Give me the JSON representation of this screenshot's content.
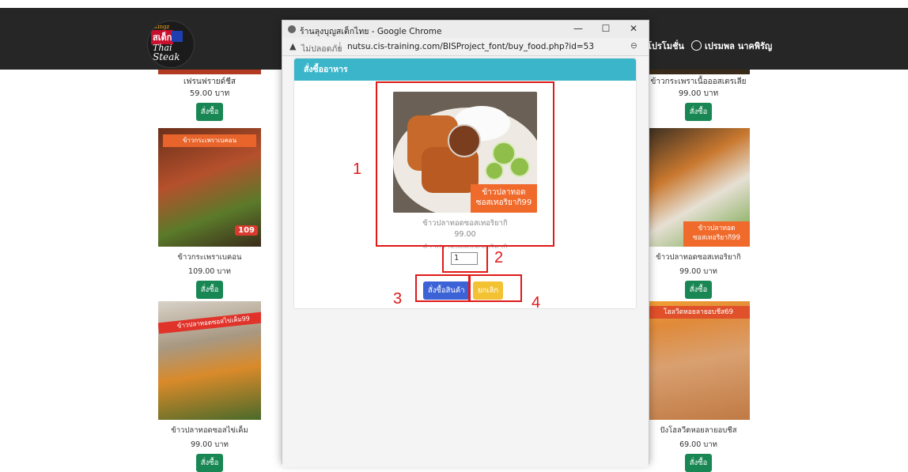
{
  "header": {
    "logo": {
      "line1": "kingz",
      "line2": "สเต็ก",
      "line3": "Thai",
      "line4": "Steak"
    },
    "nav_promo": "โปรโมชั่น",
    "nav_user": "เปรมพล นาคพิรัญ",
    "user_icon": "user-circle-icon"
  },
  "left_cards": [
    {
      "name": "เฟรนฟรายด์ชีส",
      "price": "59.00 บาท",
      "button": "สั่งซื้อ"
    },
    {
      "name": "ข้าวกระเพราเบคอน",
      "price": "109.00 บาท",
      "button": "สั่งซื้อ",
      "banner": "ข้าวกระเพราเบคอน",
      "badge": "109"
    },
    {
      "name": "ข้าวปลาทอดซอสไข่เค็ม",
      "price": "99.00 บาท",
      "button": "สั่งซื้อ",
      "banner": "ข้าวปลาทอดซอสไข่เค็ม99"
    }
  ],
  "right_cards": [
    {
      "name": "ข้าวกระเพราเนื้อออสเตรเลีย",
      "price": "99.00 บาท",
      "button": "สั่งซื้อ"
    },
    {
      "name": "ข้าวปลาทอดซอสเทอริยากิ",
      "price": "99.00 บาท",
      "button": "สั่งซื้อ",
      "tag_line1": "ข้าวปลาทอด",
      "tag_line2": "ซอสเทอริยากิ99"
    },
    {
      "name": "ปังโฮลวีตหอยลายอบชีส",
      "price": "69.00 บาท",
      "button": "สั่งซื้อ",
      "banner": "โฮลวีตหอยลายอบชีส69"
    }
  ],
  "popup": {
    "window_title": "ร้านลุงบุญสเต็กไทย - Google Chrome",
    "not_secure": "ไม่ปลอดภัย",
    "url": "nutsu.cis-training.com/BISProject_font/buy_food.php?id=53",
    "controls": {
      "minimize": "—",
      "maximize": "☐",
      "close": "✕"
    }
  },
  "modal": {
    "title": "สั่งซื้ออาหาร",
    "food_tag_line1": "ข้าวปลาทอด",
    "food_tag_line2": "ซอสเทอริยากิ99",
    "food_name": "ข้าวปลาทอดซอสเทอริยากิ",
    "food_price": "99.00",
    "food_desc": "ข้าวปลาทอดซอสเทอริยากิ",
    "quantity_value": "1",
    "buy_button": "สั่งซื้อสินค้า",
    "cancel_button": "ยกเลิก"
  },
  "annotations": [
    "1",
    "2",
    "3",
    "4"
  ],
  "colors": {
    "navbar": "#262626",
    "modal_header": "#3ab5c9",
    "buy": "#3c63d6",
    "cancel": "#f3c233",
    "order": "#198754",
    "annotation": "#e01919"
  }
}
